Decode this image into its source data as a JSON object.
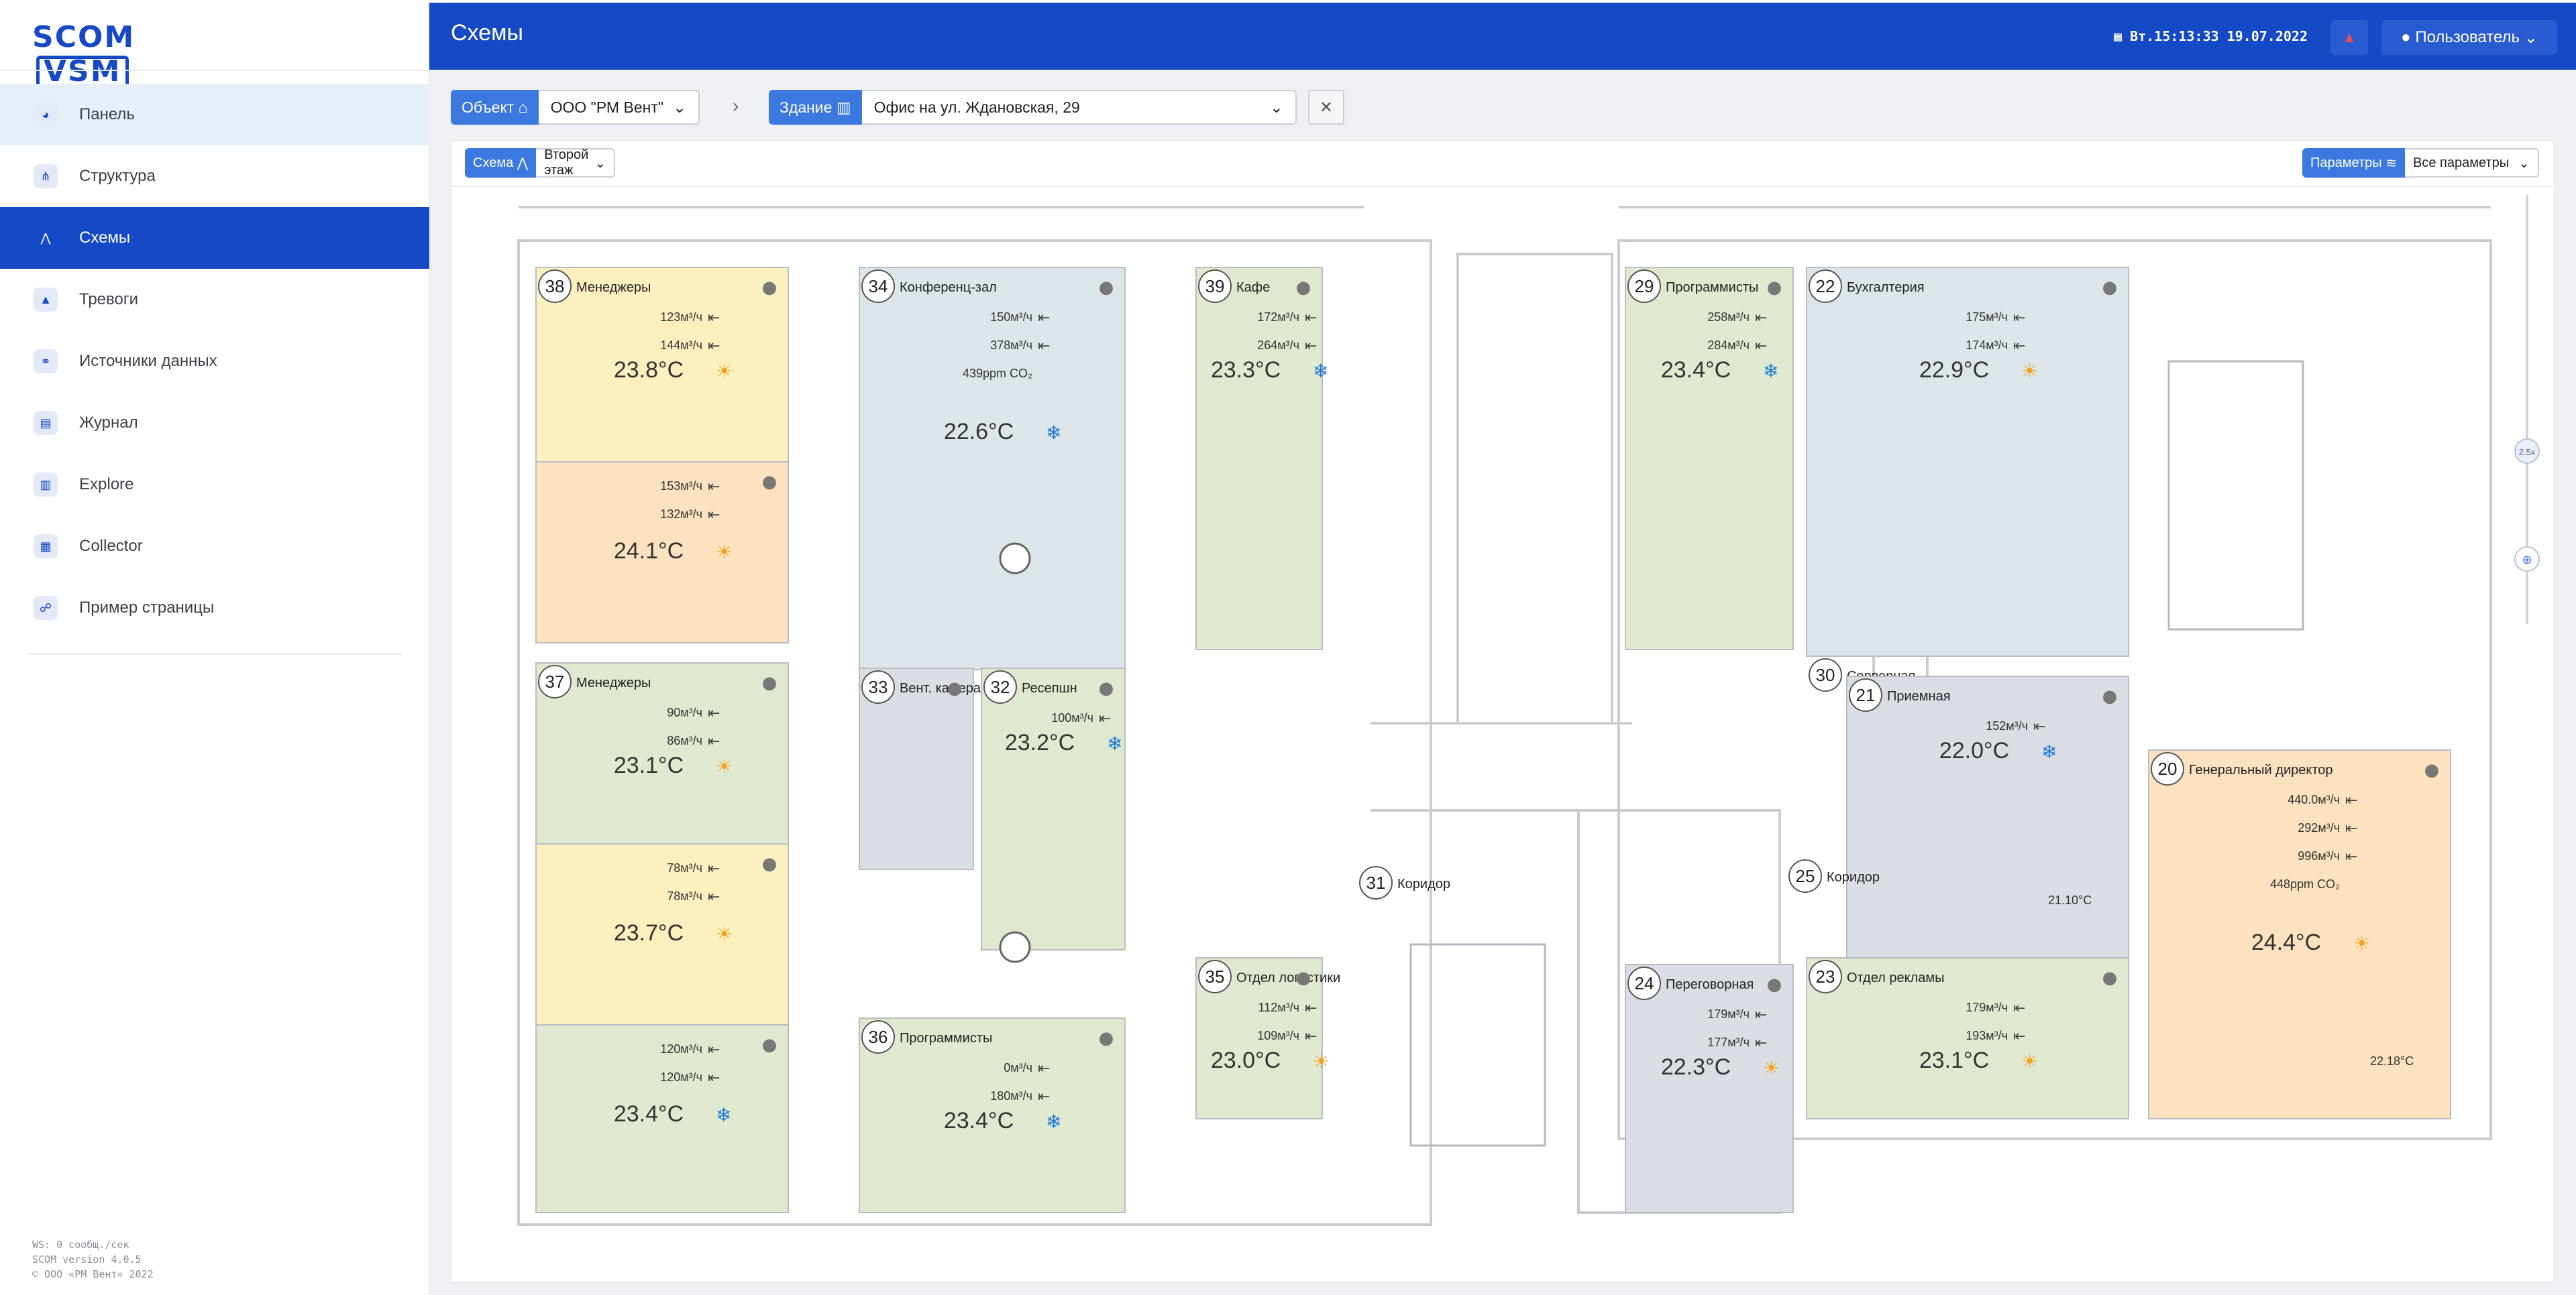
{
  "app": {
    "logo": "SCOM",
    "logo_box": "VSM",
    "page_title": "Схемы",
    "datetime": "Вт.15:13:33 19.07.2022",
    "user": "Пользователь"
  },
  "nav": [
    {
      "label": "Панель",
      "icon": "dashboard-icon"
    },
    {
      "label": "Структура",
      "icon": "structure-icon"
    },
    {
      "label": "Схемы",
      "icon": "schema-icon"
    },
    {
      "label": "Тревоги",
      "icon": "alarm-icon"
    },
    {
      "label": "Источники данных",
      "icon": "datasource-icon"
    },
    {
      "label": "Журнал",
      "icon": "journal-icon"
    },
    {
      "label": "Explore",
      "icon": "explore-icon"
    },
    {
      "label": "Collector",
      "icon": "collector-icon"
    },
    {
      "label": "Пример страницы",
      "icon": "page-icon"
    }
  ],
  "footer": {
    "ws": "WS: 0 сообщ./сек",
    "version": "SCOM version 4.0.5",
    "copyright": "© ООО «РМ Вент» 2022"
  },
  "filters": {
    "object_label": "Объект",
    "object_value": "ООО \"РМ Вент\"",
    "building_label": "Здание",
    "building_value": "Офис на ул. Ждановская, 29"
  },
  "schema": {
    "label": "Схема",
    "value": "Второй этаж",
    "params_label": "Параметры",
    "params_value": "Все параметры",
    "zoom": "2.5x"
  },
  "rooms": [
    {
      "num": "38",
      "name": "Менеджеры",
      "temp": "23.8°C",
      "mode": "heat",
      "flows": [
        "123м³/ч",
        "144м³/ч"
      ]
    },
    {
      "num": "",
      "name": "",
      "temp": "24.1°C",
      "mode": "heat",
      "flows": [
        "153м³/ч",
        "132м³/ч"
      ]
    },
    {
      "num": "34",
      "name": "Конференц-зал",
      "temp": "22.6°C",
      "mode": "cool",
      "flows": [
        "150м³/ч",
        "378м³/ч",
        "439ppm CO₂"
      ]
    },
    {
      "num": "39",
      "name": "Кафе",
      "temp": "23.3°C",
      "mode": "cool",
      "flows": [
        "172м³/ч",
        "264м³/ч"
      ]
    },
    {
      "num": "37",
      "name": "Менеджеры",
      "temp": "23.1°C",
      "mode": "heat",
      "flows": [
        "90м³/ч",
        "86м³/ч"
      ]
    },
    {
      "num": "",
      "name": "",
      "temp": "23.7°C",
      "mode": "heat",
      "flows": [
        "78м³/ч",
        "78м³/ч"
      ]
    },
    {
      "num": "",
      "name": "",
      "temp": "23.4°C",
      "mode": "cool",
      "flows": [
        "120м³/ч",
        "120м³/ч"
      ]
    },
    {
      "num": "33",
      "name": "Вент. камера",
      "temp": "",
      "mode": "",
      "flows": []
    },
    {
      "num": "32",
      "name": "Ресепшн",
      "temp": "23.2°C",
      "mode": "cool",
      "flows": [
        "100м³/ч"
      ]
    },
    {
      "num": "36",
      "name": "Программисты",
      "temp": "23.4°C",
      "mode": "cool",
      "flows": [
        "0м³/ч",
        "180м³/ч"
      ]
    },
    {
      "num": "35",
      "name": "Отдел логистики",
      "temp": "23.0°C",
      "mode": "heat",
      "flows": [
        "112м³/ч",
        "109м³/ч"
      ]
    },
    {
      "num": "31",
      "name": "Коридор",
      "temp": "",
      "mode": "",
      "flows": []
    },
    {
      "num": "29",
      "name": "Программисты",
      "temp": "23.4°C",
      "mode": "cool",
      "flows": [
        "258м³/ч",
        "284м³/ч"
      ]
    },
    {
      "num": "22",
      "name": "Бухгалтерия",
      "temp": "22.9°C",
      "mode": "heat",
      "flows": [
        "175м³/ч",
        "174м³/ч"
      ]
    },
    {
      "num": "30",
      "name": "Серверная",
      "temp": "",
      "mode": "",
      "flows": []
    },
    {
      "num": "21",
      "name": "Приемная",
      "temp": "22.0°C",
      "mode": "cool",
      "flows": [
        "152м³/ч"
      ],
      "extra": "21.10°C"
    },
    {
      "num": "25",
      "name": "Коридор",
      "temp": "",
      "mode": "",
      "flows": []
    },
    {
      "num": "20",
      "name": "Генеральный директор",
      "temp": "24.4°C",
      "mode": "heat",
      "flows": [
        "440.0м³/ч",
        "292м³/ч",
        "996м³/ч",
        "448ppm CO₂"
      ],
      "extra": "22.18°C"
    },
    {
      "num": "24",
      "name": "Переговорная",
      "temp": "22.3°C",
      "mode": "heat",
      "flows": [
        "179м³/ч",
        "177м³/ч"
      ]
    },
    {
      "num": "23",
      "name": "Отдел рекламы",
      "temp": "23.1°C",
      "mode": "heat",
      "flows": [
        "179м³/ч",
        "193м³/ч"
      ]
    }
  ],
  "colors": {
    "brand": "#1549c5",
    "heat": "#f4a21c",
    "cool": "#1f7ad6",
    "green": "#dfe9cf",
    "yellow": "#fdf0bf",
    "orange": "#fde2c0",
    "blue": "#dbe5ea",
    "grey": "#d9dde4"
  }
}
